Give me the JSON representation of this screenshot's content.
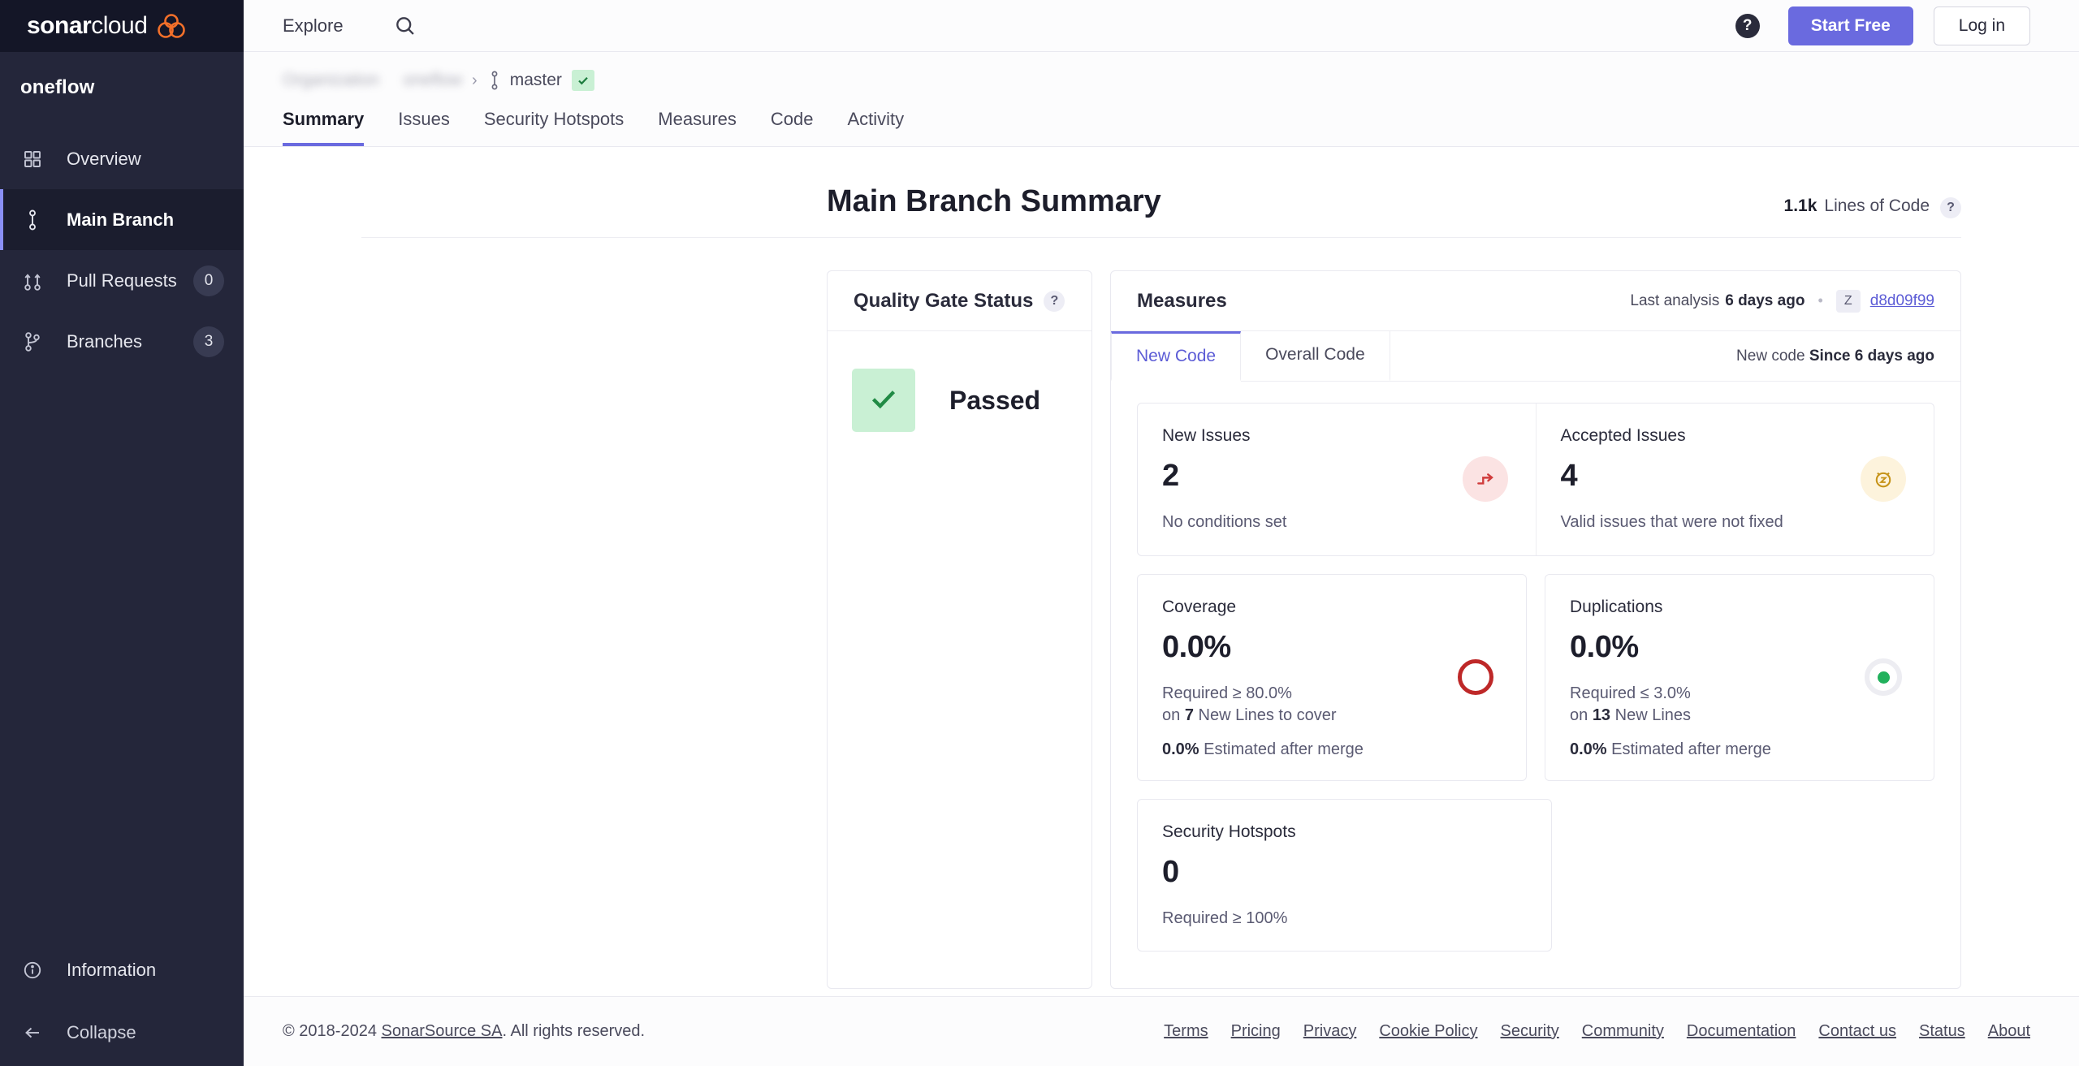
{
  "brand": {
    "bold": "sonar",
    "light": "cloud",
    "logo_icon": "sonar-logo-icon"
  },
  "sidebar": {
    "project_name": "oneflow",
    "items": [
      {
        "label": "Overview",
        "icon": "grid-icon",
        "badge": null,
        "active": false
      },
      {
        "label": "Main Branch",
        "icon": "branch-icon",
        "badge": null,
        "active": true
      },
      {
        "label": "Pull Requests",
        "icon": "pull-request-icon",
        "badge": "0",
        "active": false
      },
      {
        "label": "Branches",
        "icon": "branches-icon",
        "badge": "3",
        "active": false
      }
    ],
    "information": {
      "label": "Information",
      "icon": "info-icon"
    },
    "collapse": {
      "label": "Collapse",
      "icon": "arrow-left-icon"
    }
  },
  "topbar": {
    "explore": "Explore",
    "search_icon": "search-icon",
    "help_icon": "help-icon",
    "help_glyph": "?",
    "start_free": "Start Free",
    "log_in": "Log in"
  },
  "breadcrumb": {
    "org_redacted": "Organization",
    "project_redacted": "oneflow",
    "separator": "›",
    "branch_icon": "branch-icon",
    "branch": "master",
    "branch_status_icon": "check-icon",
    "branch_status_glyph": "✓"
  },
  "tabs": [
    {
      "label": "Summary",
      "active": true
    },
    {
      "label": "Issues",
      "active": false
    },
    {
      "label": "Security Hotspots",
      "active": false
    },
    {
      "label": "Measures",
      "active": false
    },
    {
      "label": "Code",
      "active": false
    },
    {
      "label": "Activity",
      "active": false
    }
  ],
  "page": {
    "title": "Main Branch Summary",
    "lines_of_code_value": "1.1k",
    "lines_of_code_label": "Lines of Code",
    "help_glyph": "?"
  },
  "quality_gate": {
    "title": "Quality Gate Status",
    "help_glyph": "?",
    "status": "Passed",
    "status_icon": "check-icon",
    "status_glyph": "✓",
    "status_color": "#C9F0D4"
  },
  "measures": {
    "title": "Measures",
    "last_analysis_label": "Last analysis",
    "last_analysis_value": "6 days ago",
    "separator": "•",
    "commit_icon_glyph": "Z",
    "commit_hash": "d8d09f99",
    "tabs": [
      {
        "label": "New Code",
        "active": true
      },
      {
        "label": "Overall Code",
        "active": false
      }
    ],
    "new_code_label": "New code",
    "new_code_period": "Since 6 days ago",
    "cards": {
      "new_issues": {
        "label": "New Issues",
        "value": "2",
        "note": "No conditions set",
        "indicator_icon": "trend-up-arrow-icon",
        "indicator_color": "#D03C3C"
      },
      "accepted_issues": {
        "label": "Accepted Issues",
        "value": "4",
        "note": "Valid issues that were not fixed",
        "indicator_icon": "snooze-clock-icon",
        "indicator_color": "#C69318"
      },
      "coverage": {
        "label": "Coverage",
        "value": "0.0%",
        "required": "Required ≥ 80.0%",
        "on_prefix": "on",
        "on_value": "7",
        "on_suffix": "New Lines to cover",
        "estimate_value": "0.0%",
        "estimate_label": "Estimated after merge",
        "indicator_icon": "failed-ring-icon",
        "indicator_color": "#BE2828"
      },
      "duplications": {
        "label": "Duplications",
        "value": "0.0%",
        "required": "Required ≤ 3.0%",
        "on_prefix": "on",
        "on_value": "13",
        "on_suffix": "New Lines",
        "estimate_value": "0.0%",
        "estimate_label": "Estimated after merge",
        "indicator_icon": "passed-dot-icon",
        "indicator_color": "#21B15C"
      },
      "security_hotspots": {
        "label": "Security Hotspots",
        "value": "0",
        "required": "Required ≥ 100%"
      }
    }
  },
  "footer": {
    "copyright_prefix": "© 2018-2024",
    "company": "SonarSource SA",
    "copyright_suffix": ". All rights reserved.",
    "links": [
      "Terms",
      "Pricing",
      "Privacy",
      "Cookie Policy",
      "Security",
      "Community",
      "Documentation",
      "Contact us",
      "Status",
      "About"
    ]
  }
}
